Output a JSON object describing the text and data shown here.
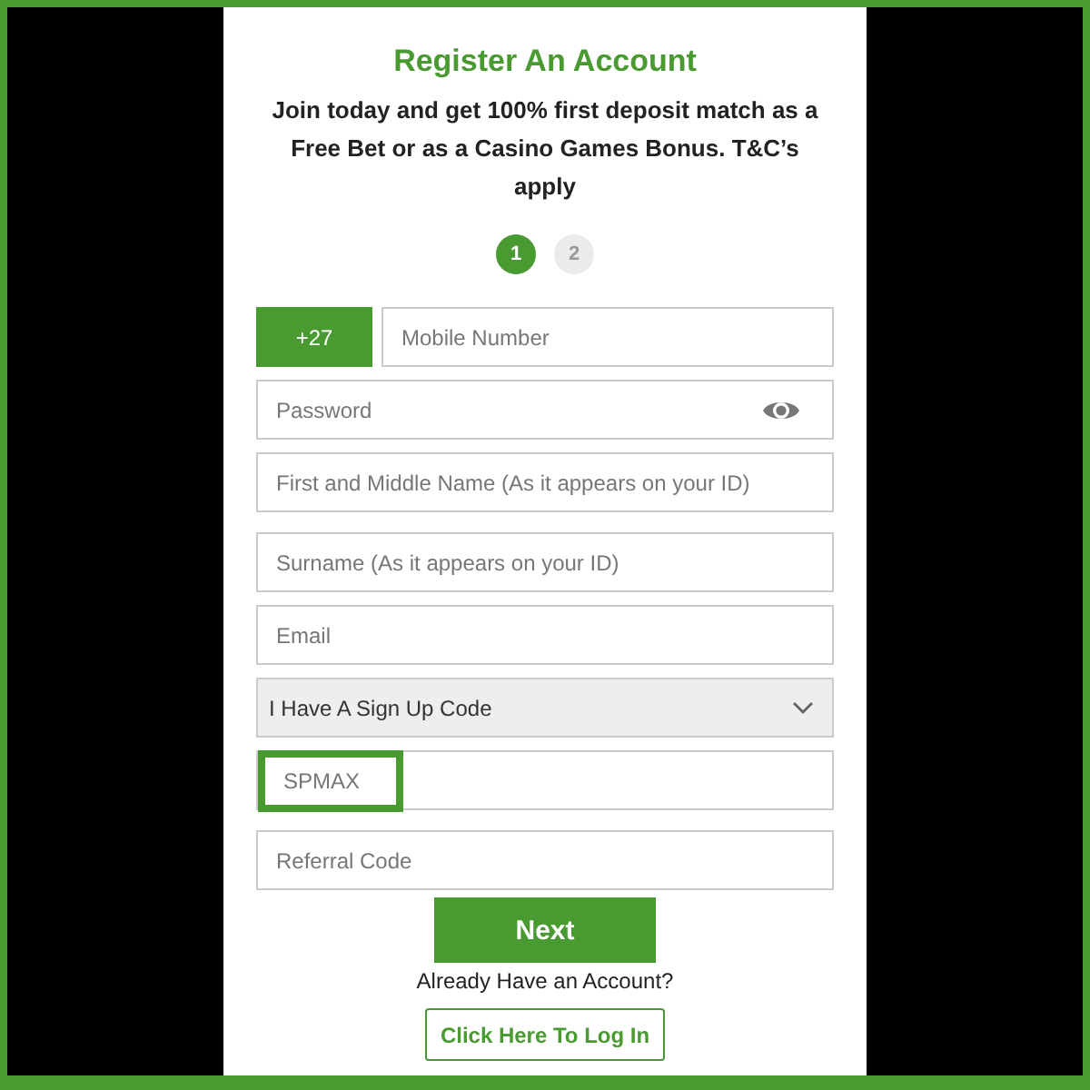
{
  "title": "Register An Account",
  "intro": "Join today and get 100% first deposit match as a Free Bet or as a Casino Games Bonus. T&C’s apply",
  "steps": [
    {
      "label": "1",
      "selected": true
    },
    {
      "label": "2",
      "selected": false
    }
  ],
  "fields": [
    {
      "kind": "phone",
      "prefix": "+27",
      "placeholder": "Mobile Number"
    },
    {
      "kind": "password",
      "placeholder": "Password"
    },
    {
      "kind": "text",
      "placeholder": "First and Middle Name (As it appears on your ID)"
    },
    {
      "kind": "text",
      "placeholder": "Surname (As it appears on your ID)"
    },
    {
      "kind": "text",
      "placeholder": "Email"
    },
    {
      "kind": "select",
      "value": "I Have A Sign Up Code"
    },
    {
      "kind": "code",
      "value": "SPMAX",
      "highlighted": true
    },
    {
      "kind": "text",
      "placeholder": "Referral Code"
    }
  ],
  "next_button": "Next",
  "login_prompt": "Already Have an Account?",
  "login_button": "Click Here To Log In"
}
